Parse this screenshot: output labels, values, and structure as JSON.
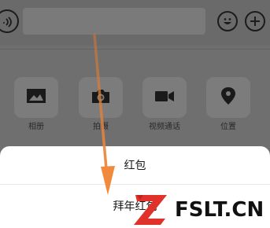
{
  "chat_input": {
    "voice_icon": "voice-wave-icon",
    "emoji_icon": "smiley-icon",
    "plus_icon": "plus-icon"
  },
  "toolbar": {
    "items": [
      {
        "label": "相册",
        "icon": "photo-album-icon"
      },
      {
        "label": "拍摄",
        "icon": "camera-icon"
      },
      {
        "label": "视频通话",
        "icon": "video-call-icon"
      },
      {
        "label": "位置",
        "icon": "location-pin-icon"
      }
    ]
  },
  "action_sheet": {
    "red_packet": "红包",
    "new_year_red_packet": "拜年红包"
  },
  "annotation": {
    "arrow_color": "#e8883b"
  },
  "watermark": {
    "text": "FSLT.CN",
    "logo_color": "#e0312b"
  }
}
